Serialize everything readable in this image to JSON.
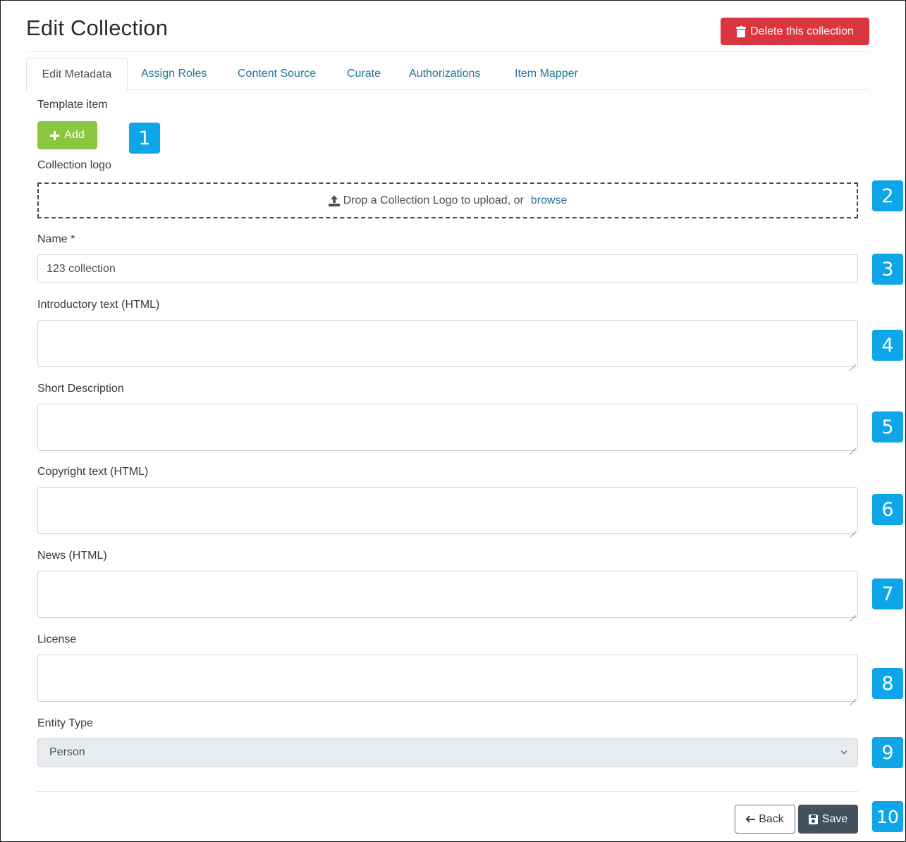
{
  "header": {
    "title": "Edit Collection",
    "delete_label": "Delete this collection",
    "delete_color": "#d9363e"
  },
  "tabs": [
    {
      "label": "Edit Metadata",
      "active": true
    },
    {
      "label": "Assign Roles",
      "active": false
    },
    {
      "label": "Content Source",
      "active": false
    },
    {
      "label": "Curate",
      "active": false
    },
    {
      "label": "Authorizations",
      "active": false
    },
    {
      "label": "Item Mapper",
      "active": false
    }
  ],
  "form": {
    "template_item": {
      "label": "Template item",
      "add_label": "Add",
      "add_color": "#8cc63f"
    },
    "logo": {
      "label": "Collection logo",
      "drop_text": "Drop a Collection Logo to upload, or",
      "browse_label": "browse"
    },
    "name": {
      "label": "Name *",
      "value": "123 collection"
    },
    "intro": {
      "label": "Introductory text (HTML)",
      "value": ""
    },
    "short_description": {
      "label": "Short Description",
      "value": ""
    },
    "copyright": {
      "label": "Copyright text (HTML)",
      "value": ""
    },
    "news": {
      "label": "News (HTML)",
      "value": ""
    },
    "license": {
      "label": "License",
      "value": ""
    },
    "entity_type": {
      "label": "Entity Type",
      "value": "Person"
    }
  },
  "actions": {
    "back_label": "Back",
    "save_label": "Save"
  },
  "badges": [
    "1",
    "2",
    "3",
    "4",
    "5",
    "6",
    "7",
    "8",
    "9",
    "10"
  ],
  "icons": {
    "delete": "trash-icon",
    "add": "plus-icon",
    "upload": "upload-icon",
    "select": "chevron-down-icon",
    "back": "arrow-left-icon",
    "save": "floppy-disk-icon"
  }
}
